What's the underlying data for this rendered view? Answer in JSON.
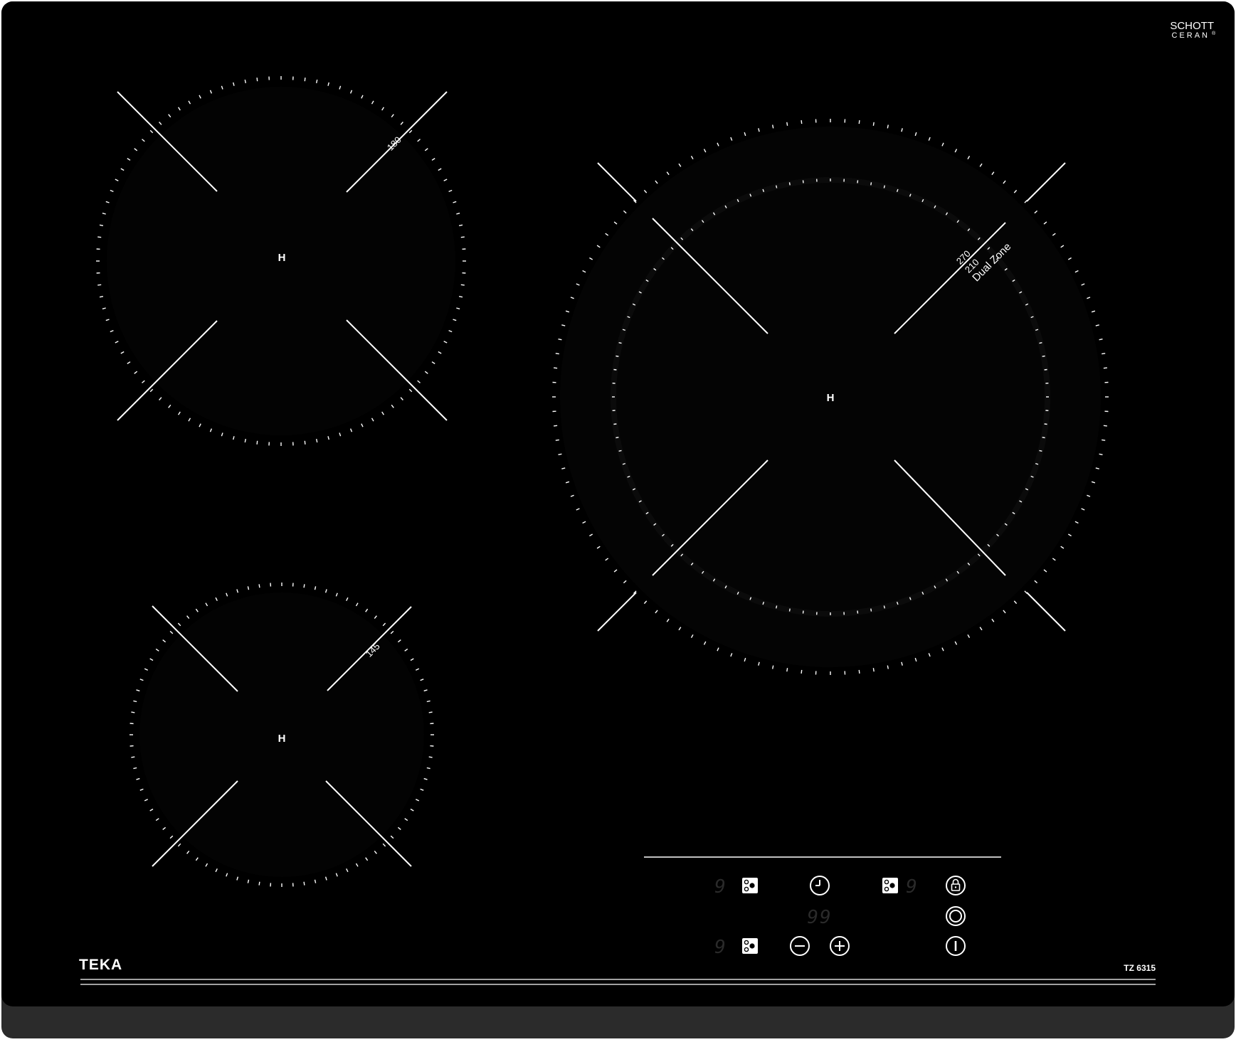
{
  "brand": {
    "manufacturer": "TEKA",
    "model": "TZ 6315",
    "glass_brand_top": "SCHOTT",
    "glass_brand_bottom": "CERAN",
    "glass_brand_mark": "®"
  },
  "zones": [
    {
      "id": "rear-left",
      "indicator": "H",
      "size_label": "180"
    },
    {
      "id": "front-left",
      "indicator": "H",
      "size_label": "145"
    },
    {
      "id": "right-dual",
      "indicator": "H",
      "size_label_outer": "270",
      "size_label_inner": "210",
      "zone_type_label": "Dual Zone"
    }
  ],
  "controls": {
    "display_left_top": "9",
    "display_left_bottom": "9",
    "display_right_top": "9",
    "timer_display": "99",
    "icons": {
      "zone_select_rear_left": "zone-select-icon",
      "zone_select_front_left": "zone-select-icon",
      "zone_select_right": "zone-select-icon",
      "timer": "clock-icon",
      "minus": "minus-icon",
      "plus": "plus-icon",
      "lock": "lock-icon",
      "dual_zone": "dual-ring-icon",
      "power": "power-icon"
    }
  },
  "colors": {
    "glass": "#000000",
    "frame": "#2b2b2b",
    "print": "#ffffff",
    "ring_marks": "#1c1c1c",
    "dim_display": "#2a2a2a"
  }
}
